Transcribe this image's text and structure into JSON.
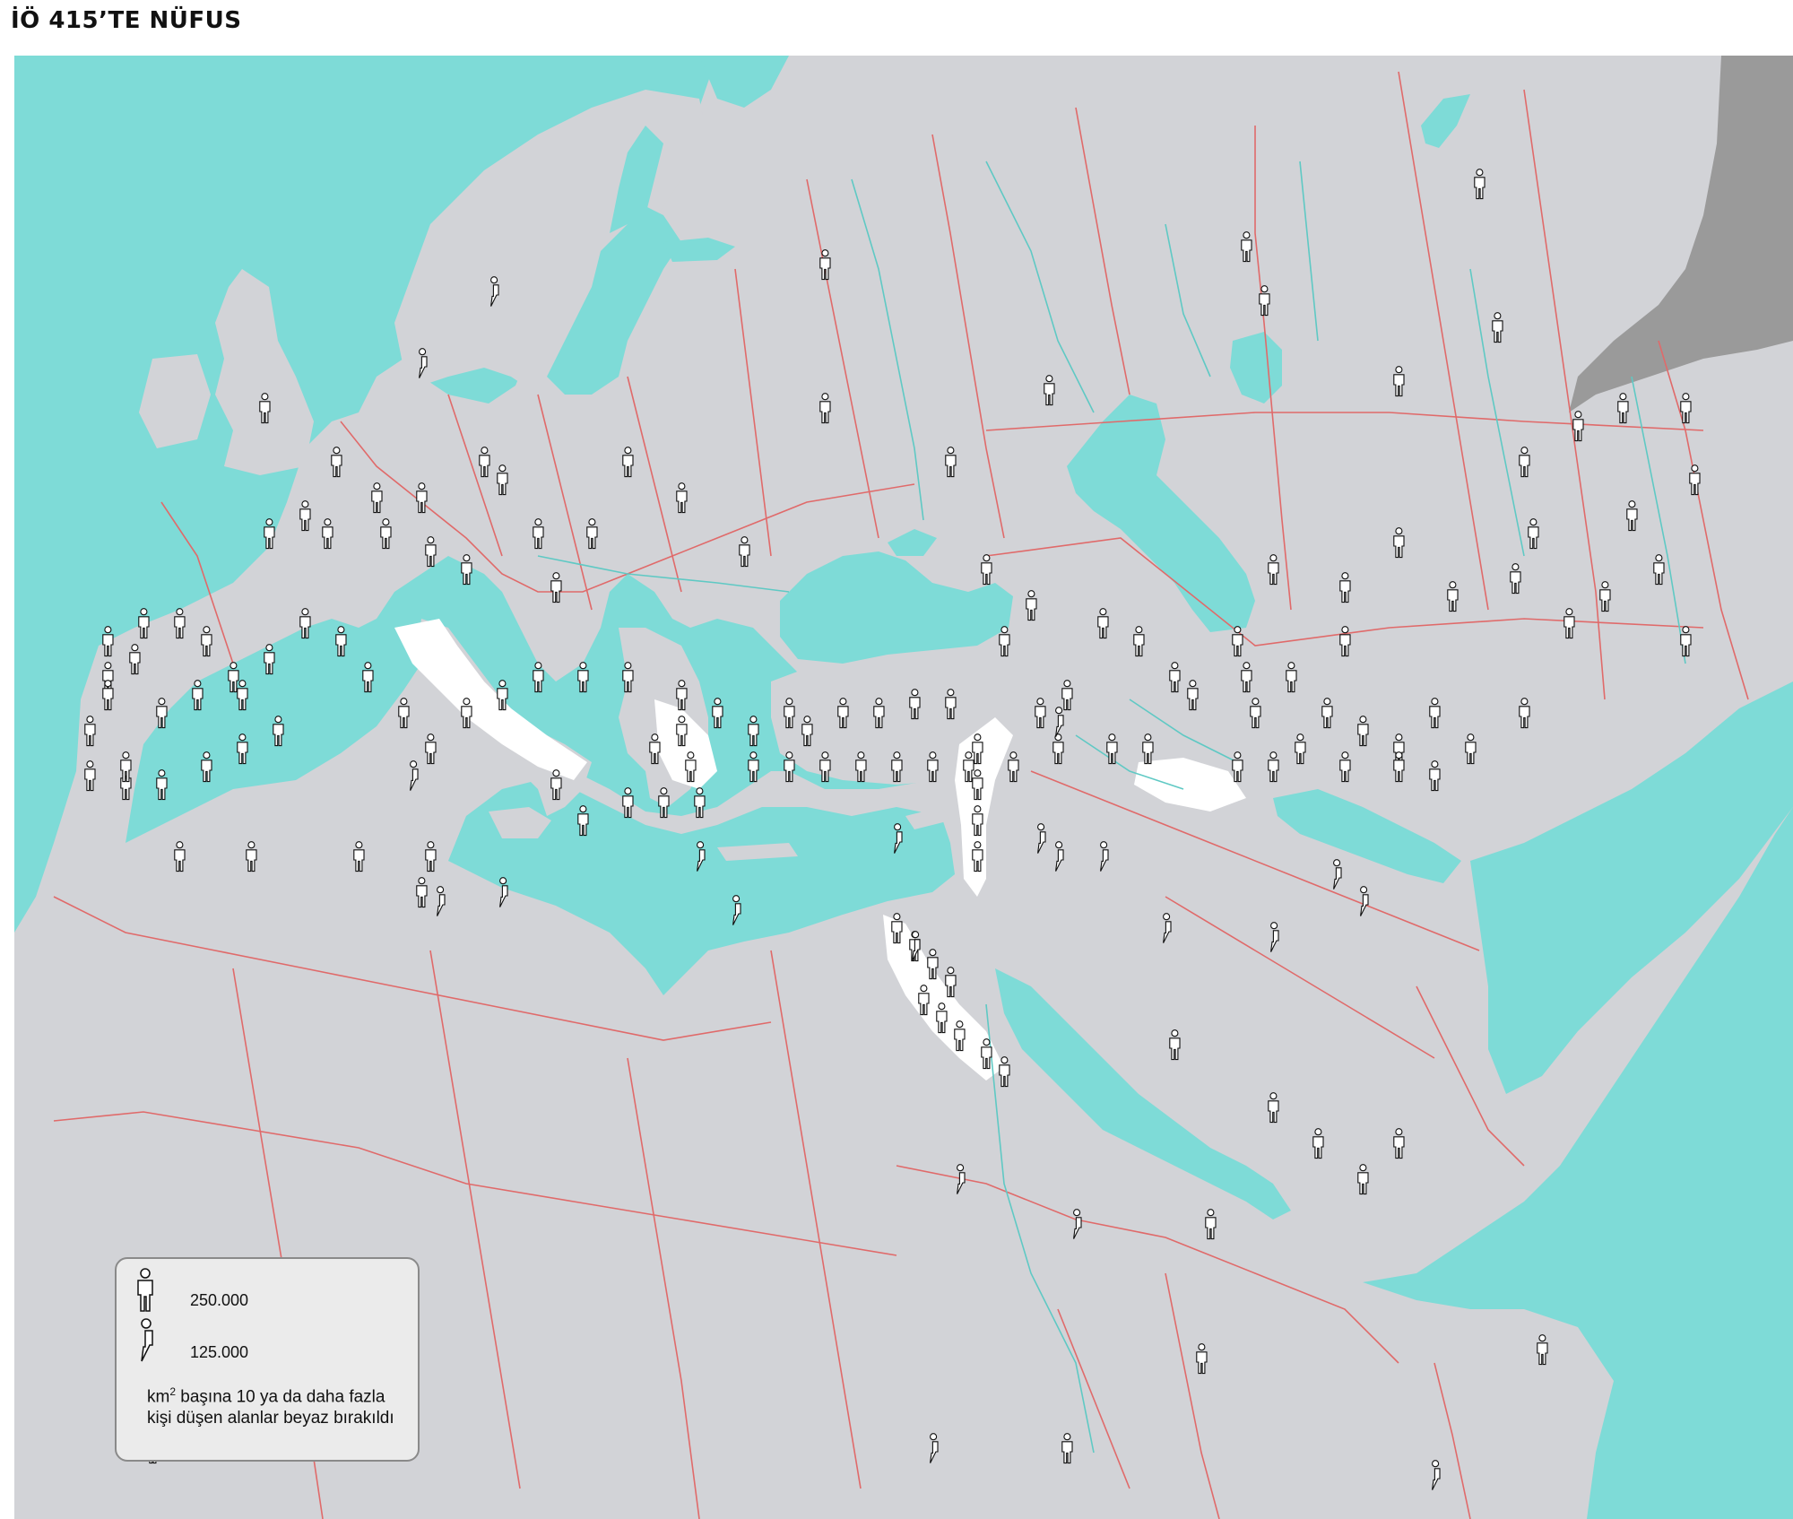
{
  "title": "İÖ 415’TE NÜFUS",
  "colors": {
    "sea": "#7edbd7",
    "land": "#d2d3d7",
    "border": "#e06a6a",
    "river": "#5fc9c4",
    "dense_area": "#ffffff",
    "unknown_area": "#9a9a9a",
    "icon_stroke": "#111111"
  },
  "legend": {
    "full_figure_label": "250.000",
    "full_figure_icon": "person-full-icon",
    "half_figure_label": "125.000",
    "half_figure_icon": "person-half-icon",
    "note_prefix": "km",
    "note_superscript": "2",
    "note_rest": " başına 10 ya da daha fazla kişi düşen alanlar beyaz bırakıldı"
  }
}
